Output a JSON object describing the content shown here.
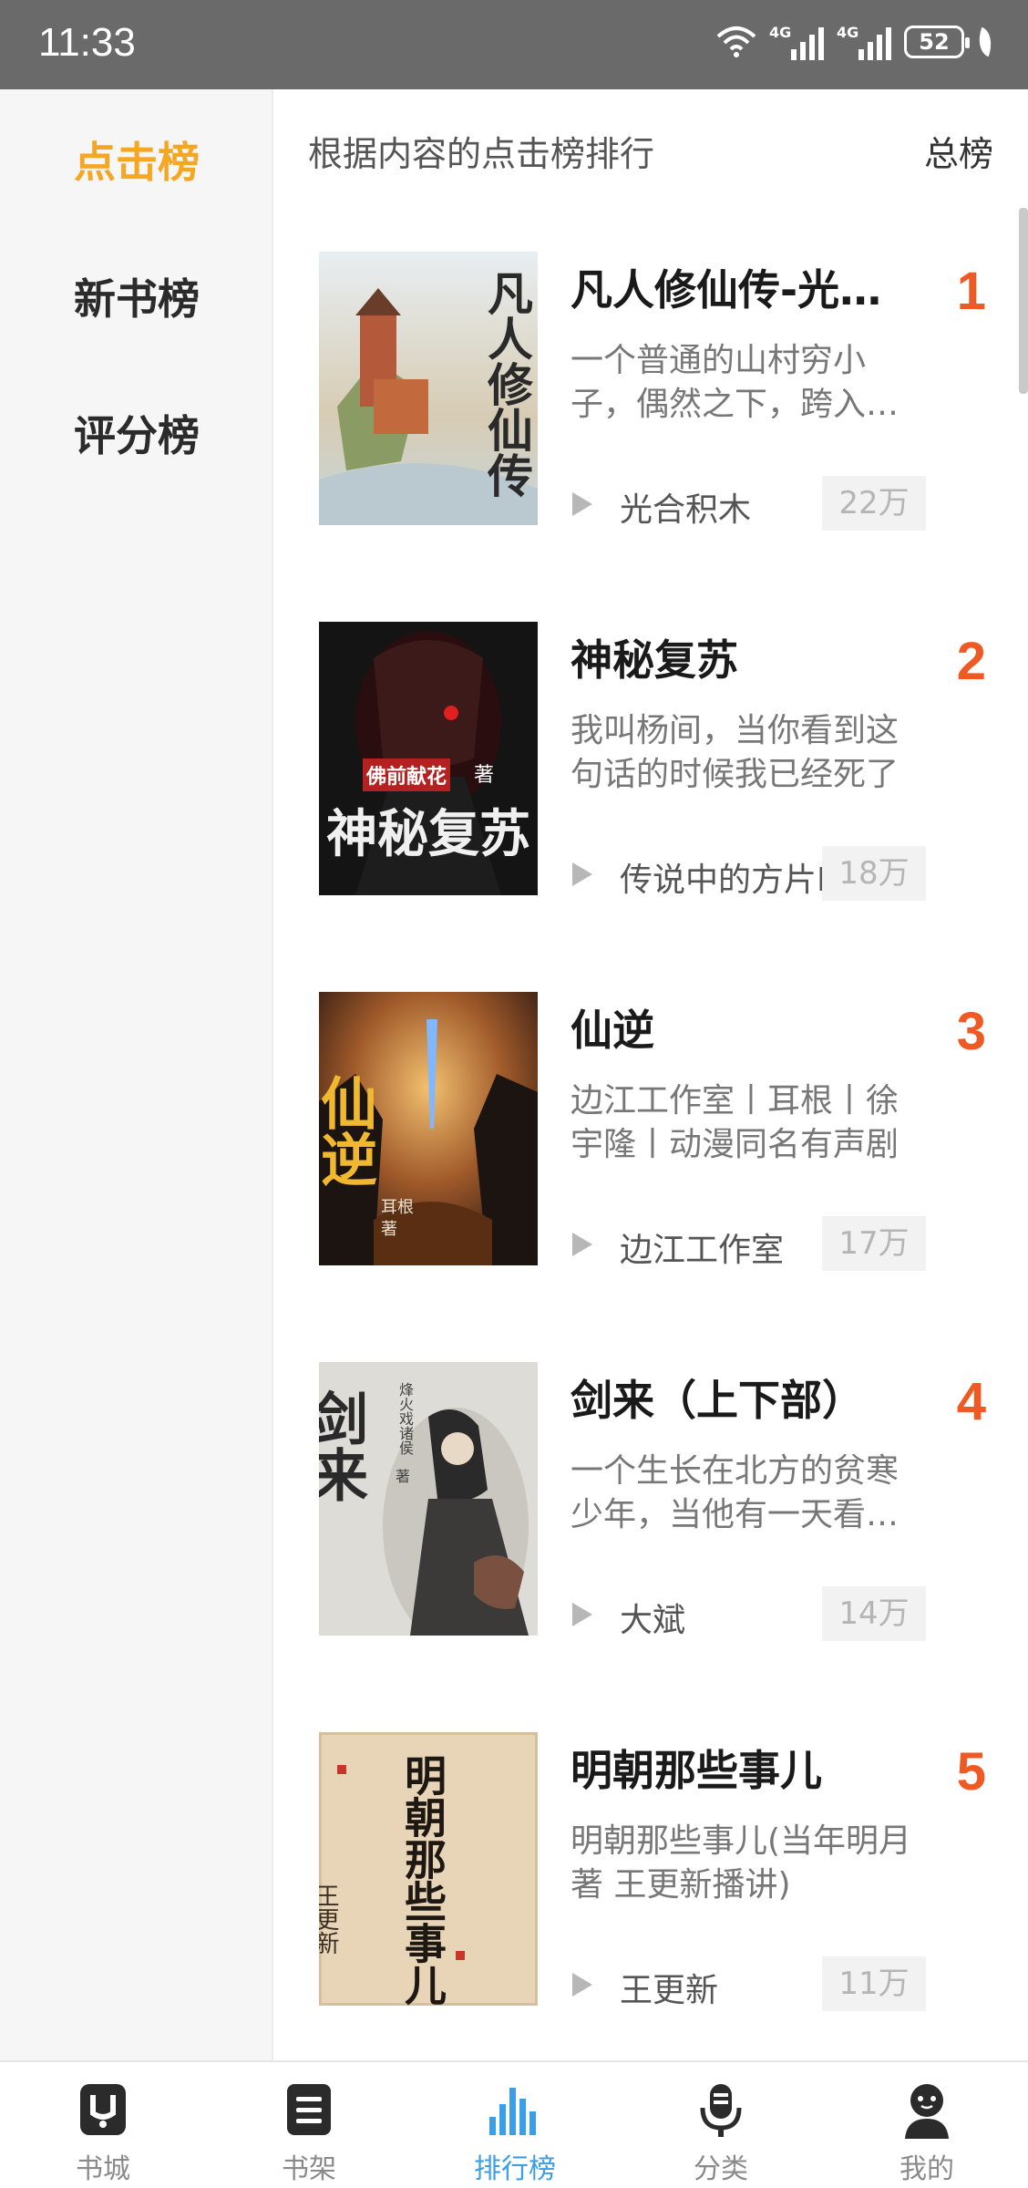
{
  "status_bar": {
    "time": "11:33",
    "battery": "52",
    "net1": "4G",
    "net2": "4G"
  },
  "sidebar": {
    "items": [
      {
        "label": "点击榜",
        "active": true
      },
      {
        "label": "新书榜",
        "active": false
      },
      {
        "label": "评分榜",
        "active": false
      }
    ]
  },
  "header": {
    "title": "根据内容的点击榜排行",
    "filter": "总榜"
  },
  "books": [
    {
      "title": "凡人修仙传-光合积木",
      "desc": "一个普通的山村穷小子，偶然之下，跨入到一个江湖小门派",
      "author": "光合积木",
      "hits": "22万",
      "rank": "1"
    },
    {
      "title": "神秘复苏",
      "desc": "我叫杨间，当你看到这句话的时候我已经死了",
      "author": "传说中的方片K",
      "hits": "18万",
      "rank": "2"
    },
    {
      "title": "仙逆",
      "desc": "边江工作室丨耳根丨徐宇隆丨动漫同名有声剧",
      "author": "边江工作室",
      "hits": "17万",
      "rank": "3"
    },
    {
      "title": "剑来（上下部）",
      "desc": "一个生长在北方的贫寒少年，当他有一天看到天下的时候",
      "author": "大斌",
      "hits": "14万",
      "rank": "4"
    },
    {
      "title": "明朝那些事儿",
      "desc": "明朝那些事儿(当年明月著 王更新播讲)",
      "author": "王更新",
      "hits": "11万",
      "rank": "5"
    }
  ],
  "covers": [
    {
      "text": "凡人修仙传",
      "colors": [
        "#dfe6ea",
        "#c9a77a",
        "#8fa06a"
      ]
    },
    {
      "text": "神秘复苏",
      "author_tag": "佛前献花",
      "suffix": "著",
      "colors": [
        "#151515",
        "#3a0e10",
        "#2a2a2a"
      ]
    },
    {
      "text": "仙逆",
      "author_tag": "耳根",
      "suffix": "著",
      "colors": [
        "#2b1a12",
        "#c8742a",
        "#4a2a1a"
      ]
    },
    {
      "text": "剑来",
      "author_tag": "烽火戏诸侯",
      "suffix": "著",
      "colors": [
        "#dcdad5",
        "#8d8a84",
        "#3a3a3a"
      ]
    },
    {
      "text": "明朝那些事儿",
      "author_tag": "王更新",
      "colors": [
        "#ead8bd",
        "#d9c4a3",
        "#2c2118"
      ]
    }
  ],
  "bottom_nav": [
    {
      "label": "书城",
      "icon": "bookstore-icon",
      "active": false
    },
    {
      "label": "书架",
      "icon": "bookshelf-icon",
      "active": false
    },
    {
      "label": "排行榜",
      "icon": "ranking-icon",
      "active": true
    },
    {
      "label": "分类",
      "icon": "microphone-icon",
      "active": false
    },
    {
      "label": "我的",
      "icon": "profile-icon",
      "active": false
    }
  ],
  "colors": {
    "accent": "#f5a623",
    "rank": "#ef5a24",
    "nav_active": "#3b9fe8"
  }
}
